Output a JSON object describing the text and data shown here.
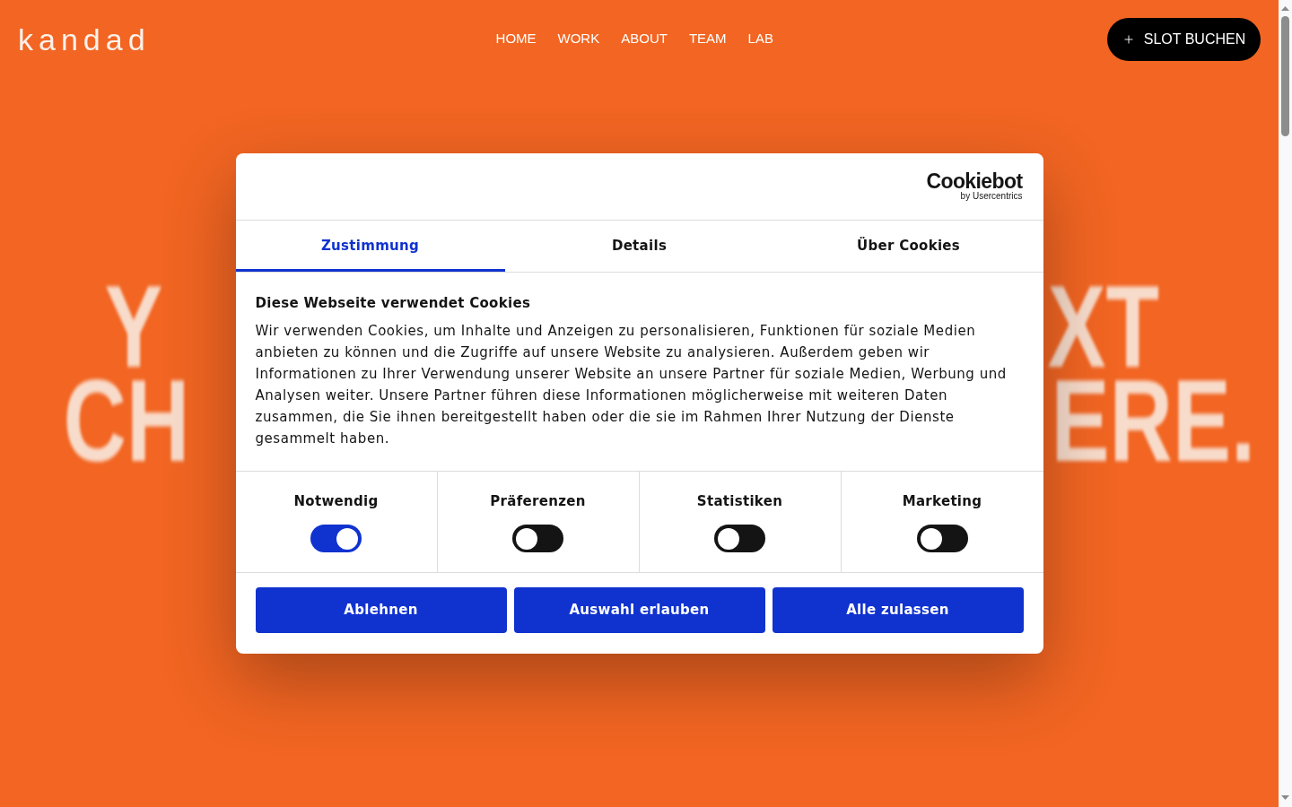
{
  "header": {
    "logo": "kandad",
    "nav": [
      "HOME",
      "WORK",
      "ABOUT",
      "TEAM",
      "LAB"
    ],
    "cta": {
      "label": "SLOT BUCHEN"
    }
  },
  "hero": {
    "lines": [
      {
        "left": "Y",
        "right": "XT"
      },
      {
        "left": "CH",
        "right": "ERE."
      }
    ]
  },
  "consent_dialog": {
    "logo": {
      "name": "Cookiebot",
      "tagline": "by Usercentrics"
    },
    "tabs": [
      {
        "label": "Zustimmung",
        "selected": true
      },
      {
        "label": "Details",
        "selected": false
      },
      {
        "label": "Über Cookies",
        "selected": false
      }
    ],
    "heading": "Diese Webseite verwendet Cookies",
    "text": "Wir verwenden Cookies, um Inhalte und Anzeigen zu personalisieren, Funktionen für soziale Medien anbieten zu können und die Zugriffe auf unsere Website zu analysieren. Außerdem geben wir Informationen zu Ihrer Verwendung unserer Website an unsere Partner für soziale Medien, Werbung und Analysen weiter. Unsere Partner führen diese Informationen möglicherweise mit weiteren Daten zusammen, die Sie ihnen bereitgestellt haben oder die sie im Rahmen Ihrer Nutzung der Dienste gesammelt haben.",
    "categories": [
      {
        "label": "Notwendig",
        "on": true
      },
      {
        "label": "Präferenzen",
        "on": false
      },
      {
        "label": "Statistiken",
        "on": false
      },
      {
        "label": "Marketing",
        "on": false
      }
    ],
    "buttons": [
      {
        "label": "Ablehnen"
      },
      {
        "label": "Auswahl erlauben"
      },
      {
        "label": "Alle zulassen"
      }
    ]
  }
}
